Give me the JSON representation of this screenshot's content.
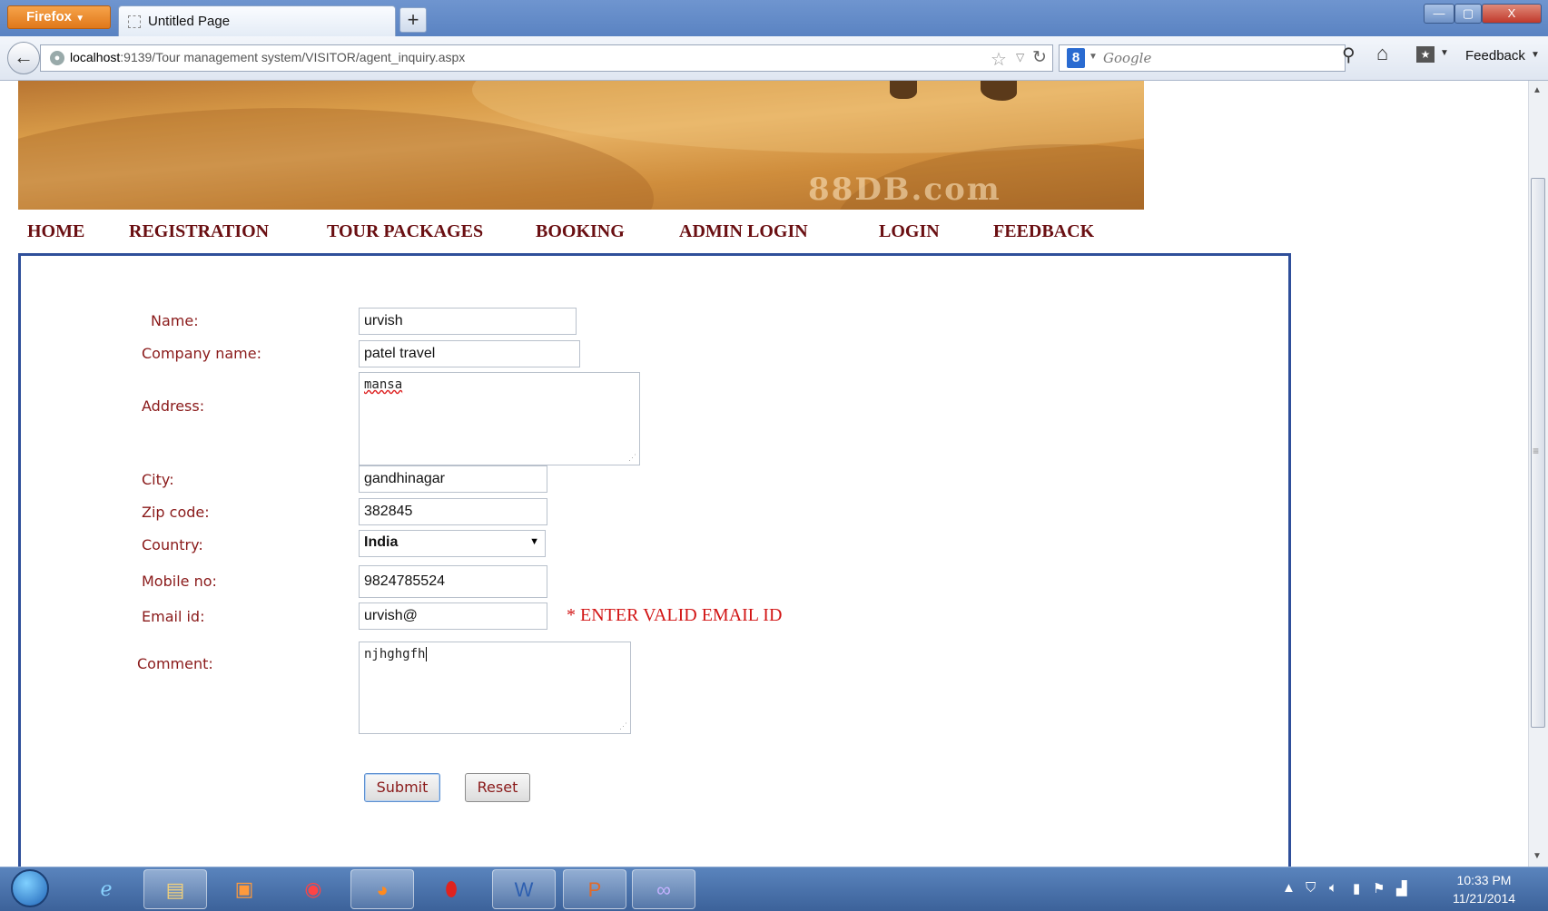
{
  "browser": {
    "menu_button": "Firefox",
    "tab_title": "Untitled Page",
    "new_tab": "+",
    "url_host": "localhost",
    "url_rest": ":9139/Tour management system/VISITOR/agent_inquiry.aspx",
    "search_placeholder": "Google",
    "feedback_label": "Feedback",
    "window_buttons": [
      "—",
      "▢",
      "X"
    ]
  },
  "site": {
    "banner_watermark": "88DB.com",
    "menu": [
      "HOME",
      "REGISTRATION",
      "TOUR PACKAGES",
      "BOOKING",
      "ADMIN LOGIN",
      "LOGIN",
      "FEEDBACK"
    ]
  },
  "form": {
    "name": {
      "label": "Name:",
      "value": "urvish"
    },
    "company": {
      "label": "Company name:",
      "value": "patel travel"
    },
    "address": {
      "label": "Address:",
      "value": "mansa"
    },
    "city": {
      "label": "City:",
      "value": "gandhinagar"
    },
    "zip": {
      "label": "Zip code:",
      "value": "382845"
    },
    "country": {
      "label": "Country:",
      "value": "India"
    },
    "mobile": {
      "label": "Mobile no:",
      "value": "9824785524"
    },
    "email": {
      "label": "Email id:",
      "value": "urvish@",
      "error": "* ENTER VALID EMAIL ID"
    },
    "comment": {
      "label": "Comment:",
      "value": "njhghgfh"
    },
    "submit_label": "Submit",
    "reset_label": "Reset"
  },
  "taskbar": {
    "apps": [
      "internet-explorer",
      "file-explorer",
      "media-player",
      "chrome",
      "firefox",
      "opera",
      "word",
      "powerpoint",
      "visual-studio"
    ],
    "time": "10:33 PM",
    "date": "11/21/2014"
  },
  "colors": {
    "menu_text": "#6a0f12",
    "label_text": "#8a1a1a",
    "error_text": "#d21414",
    "panel_border": "#2f4f9a"
  }
}
